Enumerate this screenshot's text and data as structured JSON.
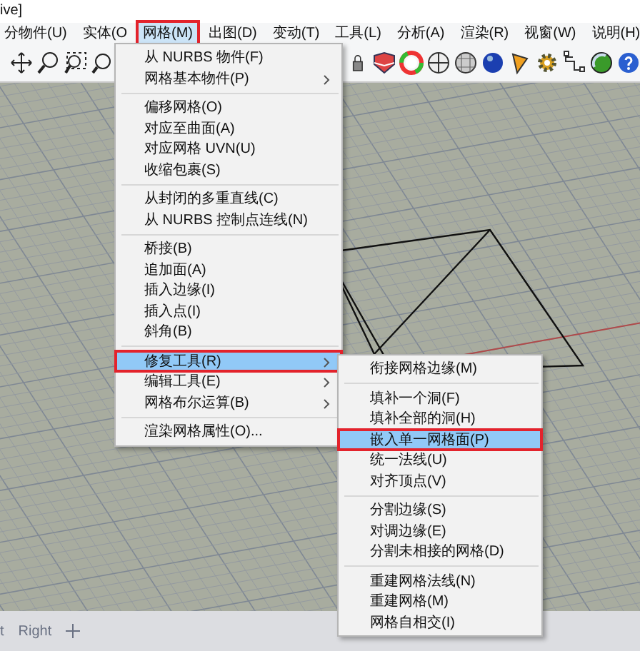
{
  "window": {
    "title": "ive]"
  },
  "menubar": [
    {
      "label": "分物件(U)",
      "selected": false,
      "marked": false
    },
    {
      "label": "实体(O",
      "selected": false,
      "marked": false
    },
    {
      "label": "网格(M)",
      "selected": true,
      "marked": true
    },
    {
      "label": "出图(D)",
      "selected": false,
      "marked": false
    },
    {
      "label": "变动(T)",
      "selected": false,
      "marked": false
    },
    {
      "label": "工具(L)",
      "selected": false,
      "marked": false
    },
    {
      "label": "分析(A)",
      "selected": false,
      "marked": false
    },
    {
      "label": "渲染(R)",
      "selected": false,
      "marked": false
    },
    {
      "label": "视窗(W)",
      "selected": false,
      "marked": false
    },
    {
      "label": "说明(H)",
      "selected": false,
      "marked": false
    }
  ],
  "menu": {
    "groups": [
      [
        {
          "label": "从 NURBS 物件(F)",
          "submenu": false,
          "selected": false,
          "marked": false
        },
        {
          "label": "网格基本物件(P)",
          "submenu": true,
          "selected": false,
          "marked": false
        }
      ],
      [
        {
          "label": "偏移网格(O)",
          "submenu": false,
          "selected": false,
          "marked": false
        },
        {
          "label": "对应至曲面(A)",
          "submenu": false,
          "selected": false,
          "marked": false
        },
        {
          "label": "对应网格 UVN(U)",
          "submenu": false,
          "selected": false,
          "marked": false
        },
        {
          "label": "收缩包裹(S)",
          "submenu": false,
          "selected": false,
          "marked": false
        }
      ],
      [
        {
          "label": "从封闭的多重直线(C)",
          "submenu": false,
          "selected": false,
          "marked": false
        },
        {
          "label": "从 NURBS 控制点连线(N)",
          "submenu": false,
          "selected": false,
          "marked": false
        }
      ],
      [
        {
          "label": "桥接(B)",
          "submenu": false,
          "selected": false,
          "marked": false
        },
        {
          "label": "追加面(A)",
          "submenu": false,
          "selected": false,
          "marked": false
        },
        {
          "label": "插入边缘(I)",
          "submenu": false,
          "selected": false,
          "marked": false
        },
        {
          "label": "插入点(I)",
          "submenu": false,
          "selected": false,
          "marked": false
        },
        {
          "label": "斜角(B)",
          "submenu": false,
          "selected": false,
          "marked": false
        }
      ],
      [
        {
          "label": "修复工具(R)",
          "submenu": true,
          "selected": true,
          "marked": true
        },
        {
          "label": "编辑工具(E)",
          "submenu": true,
          "selected": false,
          "marked": false
        },
        {
          "label": "网格布尔运算(B)",
          "submenu": true,
          "selected": false,
          "marked": false
        }
      ],
      [
        {
          "label": "渲染网格属性(O)...",
          "submenu": false,
          "selected": false,
          "marked": false
        }
      ]
    ]
  },
  "submenu": {
    "groups": [
      [
        {
          "label": "衔接网格边缘(M)",
          "submenu": false,
          "selected": false,
          "marked": false
        }
      ],
      [
        {
          "label": "填补一个洞(F)",
          "submenu": false,
          "selected": false,
          "marked": false
        },
        {
          "label": "填补全部的洞(H)",
          "submenu": false,
          "selected": false,
          "marked": false
        },
        {
          "label": "嵌入单一网格面(P)",
          "submenu": false,
          "selected": true,
          "marked": true
        },
        {
          "label": "统一法线(U)",
          "submenu": false,
          "selected": false,
          "marked": false
        },
        {
          "label": "对齐顶点(V)",
          "submenu": false,
          "selected": false,
          "marked": false
        }
      ],
      [
        {
          "label": "分割边缘(S)",
          "submenu": false,
          "selected": false,
          "marked": false
        },
        {
          "label": "对调边缘(E)",
          "submenu": false,
          "selected": false,
          "marked": false
        },
        {
          "label": "分割未相接的网格(D)",
          "submenu": false,
          "selected": false,
          "marked": false
        }
      ],
      [
        {
          "label": "重建网格法线(N)",
          "submenu": false,
          "selected": false,
          "marked": false
        },
        {
          "label": "重建网格(M)",
          "submenu": false,
          "selected": false,
          "marked": false
        },
        {
          "label": "网格自相交(I)",
          "submenu": false,
          "selected": false,
          "marked": false
        }
      ]
    ]
  },
  "viewport_tabs": [
    {
      "label": "t",
      "selected": false
    },
    {
      "label": "Right",
      "selected": false
    }
  ]
}
